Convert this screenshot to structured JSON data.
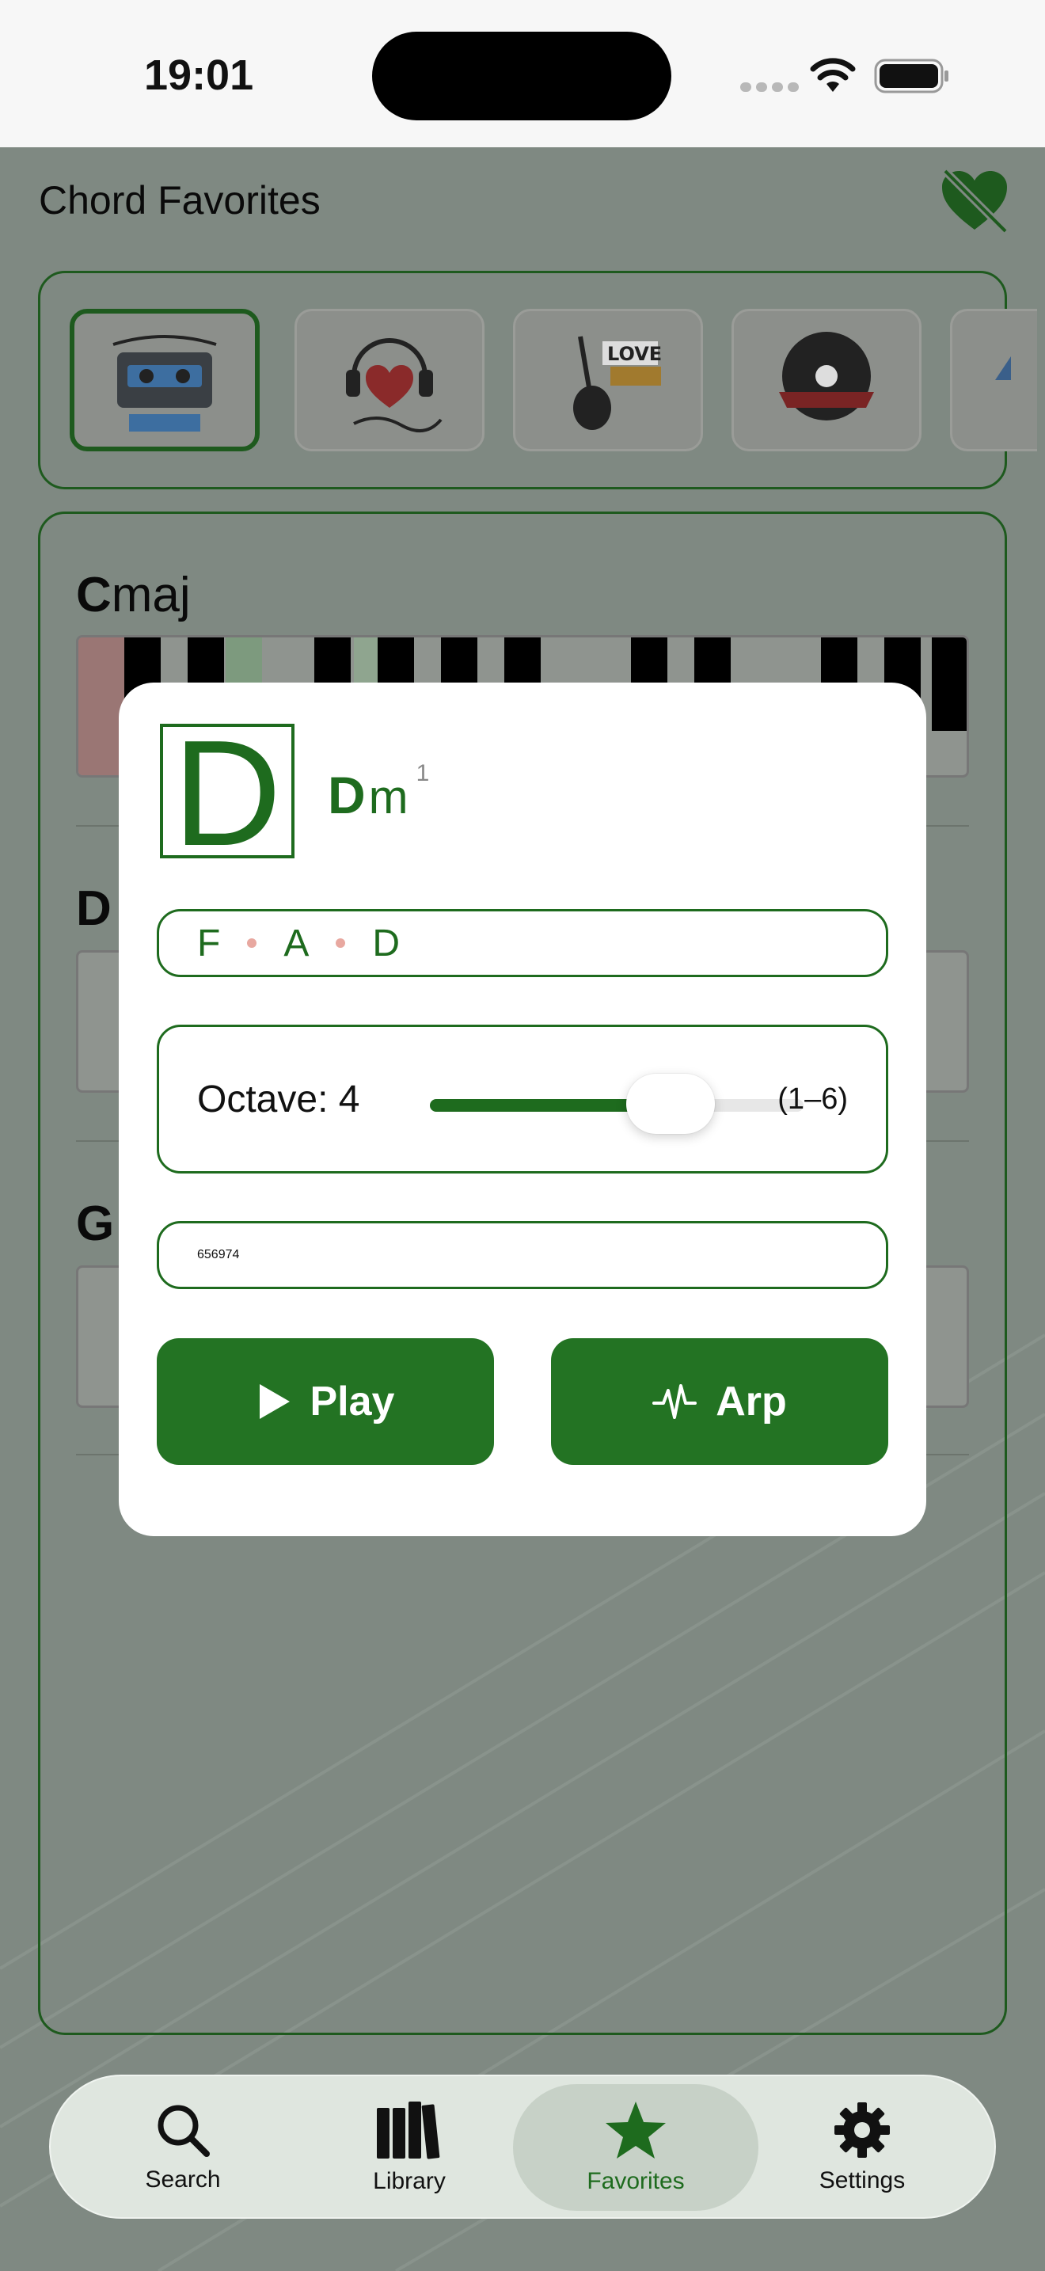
{
  "status_bar": {
    "time": "19:01"
  },
  "header": {
    "title": "Chord Favorites"
  },
  "stickers": [
    {
      "name": "music-makes-everything-better",
      "selected": true
    },
    {
      "name": "love-music-headphones",
      "selected": false
    },
    {
      "name": "love-music-guitar",
      "selected": false
    },
    {
      "name": "relax-and-listen-vinyl",
      "selected": false
    },
    {
      "name": "love-partial",
      "selected": false
    }
  ],
  "list": {
    "rows": [
      {
        "root": "C",
        "quality": "maj"
      },
      {
        "root": "D",
        "quality": ""
      },
      {
        "root": "G",
        "quality": ""
      }
    ]
  },
  "modal": {
    "root_letter": "D",
    "chord_root": "D",
    "chord_quality": "m",
    "inversion": "1",
    "notes": [
      "F",
      "A",
      "D"
    ],
    "octave_label": "Octave: 4",
    "octave_value": 4,
    "octave_min": 1,
    "octave_max": 6,
    "octave_range": "(1–6)",
    "midi": [
      "65",
      "69",
      "74"
    ],
    "play_label": "Play",
    "arp_label": "Arp"
  },
  "tabs": [
    {
      "label": "Search",
      "icon": "search-icon",
      "active": false
    },
    {
      "label": "Library",
      "icon": "library-icon",
      "active": false
    },
    {
      "label": "Favorites",
      "icon": "star-icon",
      "active": true
    },
    {
      "label": "Settings",
      "icon": "gear-icon",
      "active": false
    }
  ],
  "colors": {
    "accent": "#237323",
    "note_dot": "#e8a8a0"
  }
}
